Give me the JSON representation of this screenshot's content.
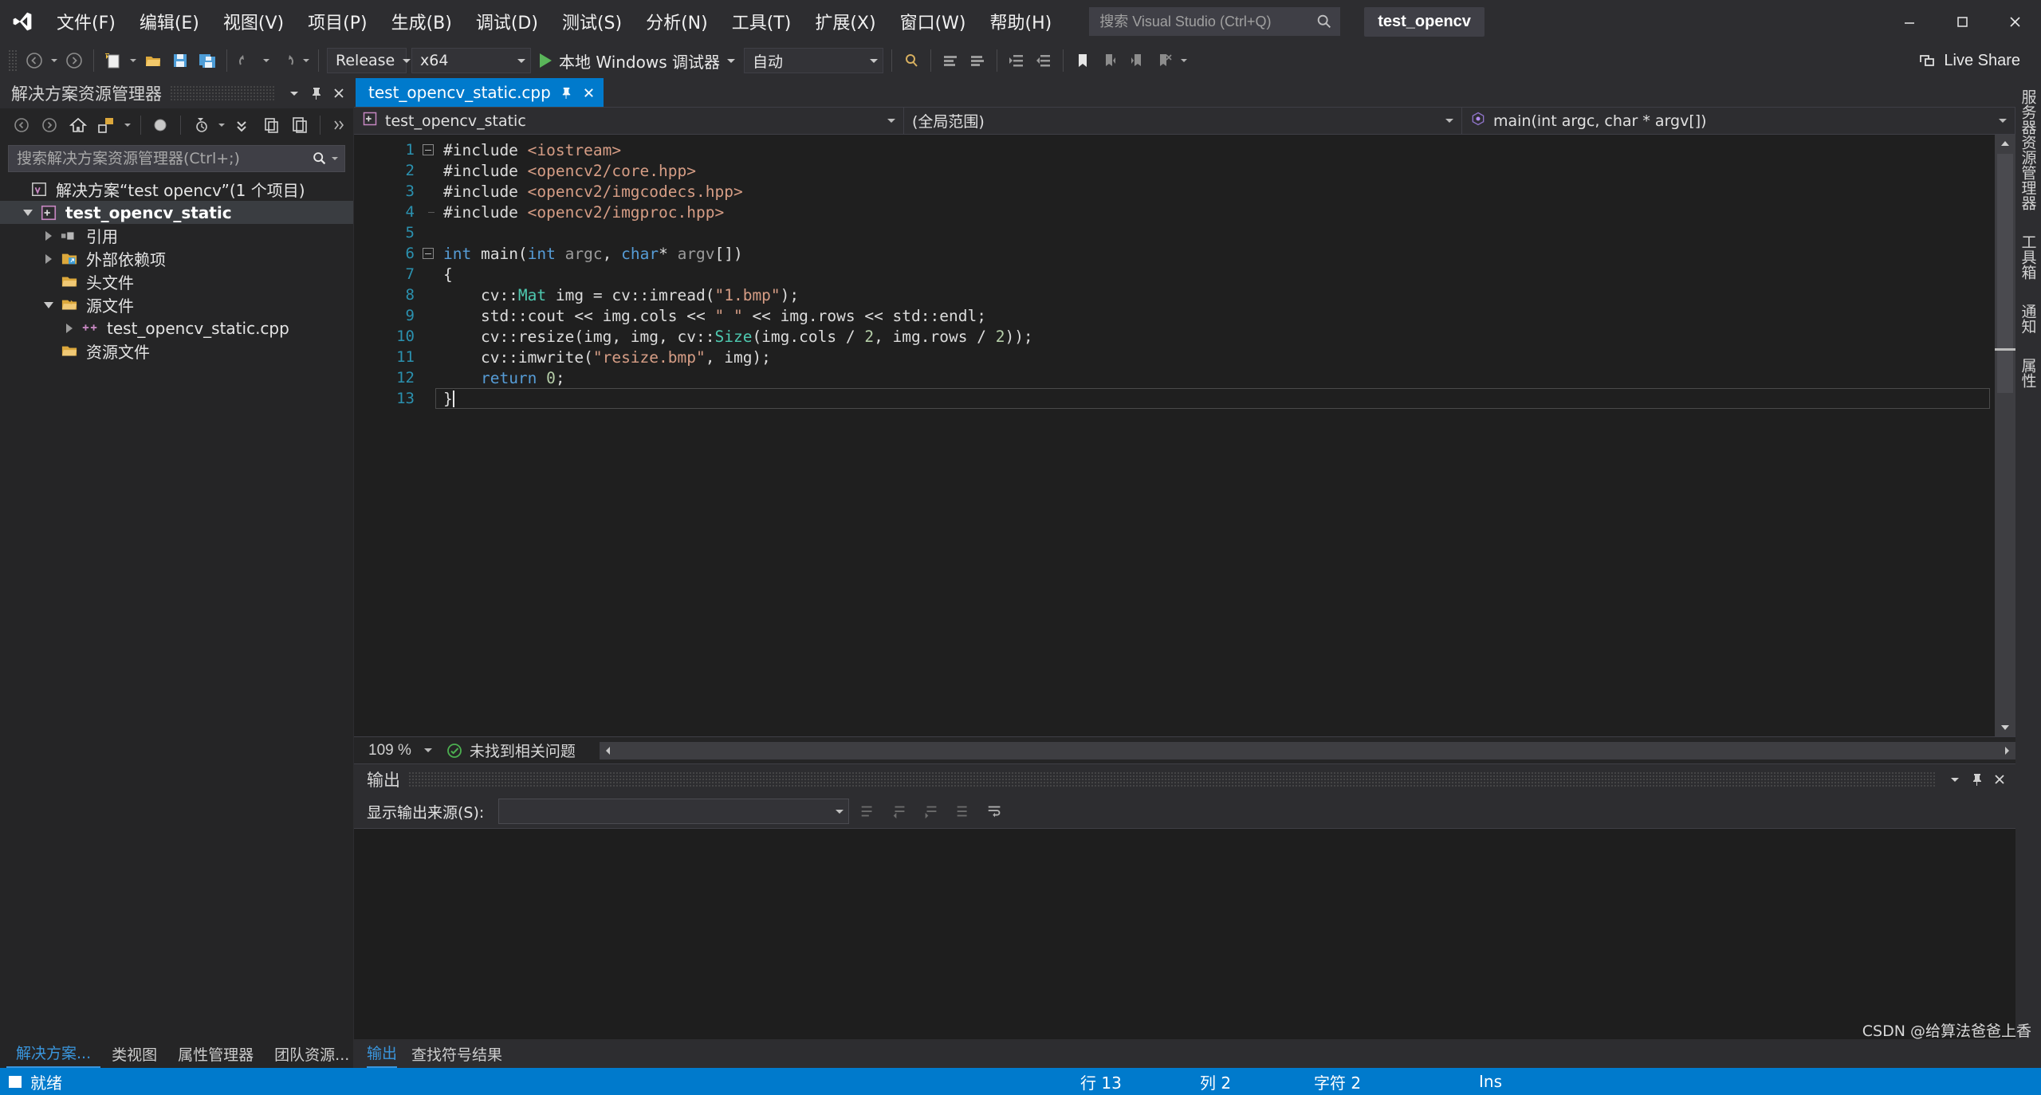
{
  "titlebar": {
    "logo_icon": "visual-studio-logo",
    "menus": [
      {
        "label": "文件(F)"
      },
      {
        "label": "编辑(E)"
      },
      {
        "label": "视图(V)"
      },
      {
        "label": "项目(P)"
      },
      {
        "label": "生成(B)"
      },
      {
        "label": "调试(D)"
      },
      {
        "label": "测试(S)"
      },
      {
        "label": "分析(N)"
      },
      {
        "label": "工具(T)"
      },
      {
        "label": "扩展(X)"
      },
      {
        "label": "窗口(W)"
      },
      {
        "label": "帮助(H)"
      }
    ],
    "search_placeholder": "搜索 Visual Studio (Ctrl+Q)",
    "search_value": "",
    "project_chip": "test_opencv",
    "window_buttons": {
      "minimize": "minimize-icon",
      "maximize": "maximize-icon",
      "close": "close-icon"
    }
  },
  "toolbar": {
    "nav_back": "navigate-back-icon",
    "nav_forward": "navigate-forward-icon",
    "new_project": "new-project-icon",
    "open_file": "open-file-icon",
    "save": "save-icon",
    "save_all": "save-all-icon",
    "undo": "undo-icon",
    "redo": "redo-icon",
    "configuration": "Release",
    "platform": "x64",
    "debug_target": "本地 Windows 调试器",
    "auto_mode": "自动",
    "live_share": "Live Share"
  },
  "solution_explorer": {
    "title": "解决方案资源管理器",
    "dropdown_icon": "chevron-down-icon",
    "pin_icon": "pin-icon",
    "close_icon": "close-icon",
    "toolbar_icons": [
      "back-icon",
      "forward-icon",
      "home-icon",
      "sync-with-active-doc-icon",
      "refresh-icon",
      "show-all-files-icon",
      "collapse-all-icon",
      "view-icon",
      "properties-icon"
    ],
    "search_placeholder": "搜索解决方案资源管理器(Ctrl+;)",
    "search_value": "",
    "tree": [
      {
        "label": "解决方案“test opencv”(1 个项目)",
        "icon": "solution-icon",
        "indent": 0,
        "twist": "none",
        "selected": false
      },
      {
        "label": "test_opencv_static",
        "icon": "cpp-project-icon",
        "indent": 1,
        "twist": "expanded",
        "selected": true
      },
      {
        "label": "引用",
        "icon": "references-icon",
        "indent": 2,
        "twist": "collapsed",
        "selected": false
      },
      {
        "label": "外部依赖项",
        "icon": "external-deps-icon",
        "indent": 2,
        "twist": "collapsed",
        "selected": false
      },
      {
        "label": "头文件",
        "icon": "folder-icon",
        "indent": 2,
        "twist": "none",
        "selected": false
      },
      {
        "label": "源文件",
        "icon": "folder-open-icon",
        "indent": 2,
        "twist": "expanded",
        "selected": false
      },
      {
        "label": "test_opencv_static.cpp",
        "icon": "cpp-file-icon",
        "indent": 3,
        "twist": "collapsed",
        "selected": false
      },
      {
        "label": "资源文件",
        "icon": "folder-icon",
        "indent": 2,
        "twist": "none",
        "selected": false
      }
    ],
    "bottom_tabs": [
      {
        "label": "解决方案...",
        "active": true
      },
      {
        "label": "类视图",
        "active": false
      },
      {
        "label": "属性管理器",
        "active": false
      },
      {
        "label": "团队资源...",
        "active": false
      }
    ]
  },
  "editor": {
    "tab_label": "test_opencv_static.cpp",
    "tab_pin_icon": "pin-icon",
    "tab_close_icon": "close-icon",
    "nav_project": "test_opencv_static",
    "nav_project_icon": "cpp-project-icon",
    "nav_scope": "(全局范围)",
    "nav_member": "main(int argc, char * argv[])",
    "nav_member_icon": "method-icon",
    "zoom_level": "109 %",
    "issue_status": "未找到相关问题",
    "issue_icon": "check-circle-icon",
    "lines": [
      {
        "n": "1",
        "fold": "start",
        "tokens": [
          {
            "t": "#include ",
            "c": "k-white"
          },
          {
            "t": "<iostream>",
            "c": "k-str"
          }
        ]
      },
      {
        "n": "2",
        "fold": "mid",
        "tokens": [
          {
            "t": "#include ",
            "c": "k-white"
          },
          {
            "t": "<opencv2/core.hpp>",
            "c": "k-str"
          }
        ]
      },
      {
        "n": "3",
        "fold": "mid",
        "tokens": [
          {
            "t": "#include ",
            "c": "k-white"
          },
          {
            "t": "<opencv2/imgcodecs.hpp>",
            "c": "k-str"
          }
        ]
      },
      {
        "n": "4",
        "fold": "end",
        "tokens": [
          {
            "t": "#include ",
            "c": "k-white"
          },
          {
            "t": "<opencv2/imgproc.hpp>",
            "c": "k-str"
          }
        ]
      },
      {
        "n": "5",
        "fold": "none",
        "tokens": []
      },
      {
        "n": "6",
        "fold": "start",
        "tokens": [
          {
            "t": "int",
            "c": "k-blue"
          },
          {
            "t": " main(",
            "c": "k-white"
          },
          {
            "t": "int",
            "c": "k-blue"
          },
          {
            "t": " ",
            "c": "k-white"
          },
          {
            "t": "argc",
            "c": "k-id"
          },
          {
            "t": ", ",
            "c": "k-white"
          },
          {
            "t": "char",
            "c": "k-blue"
          },
          {
            "t": "* ",
            "c": "k-white"
          },
          {
            "t": "argv",
            "c": "k-id"
          },
          {
            "t": "[])",
            "c": "k-white"
          }
        ]
      },
      {
        "n": "7",
        "fold": "bar",
        "tokens": [
          {
            "t": "{",
            "c": "k-white"
          }
        ]
      },
      {
        "n": "8",
        "fold": "bardot",
        "tokens": [
          {
            "t": "    cv::",
            "c": "k-white"
          },
          {
            "t": "Mat",
            "c": "k-type"
          },
          {
            "t": " img = cv::imread(",
            "c": "k-white"
          },
          {
            "t": "\"1.bmp\"",
            "c": "k-str"
          },
          {
            "t": ");",
            "c": "k-white"
          }
        ]
      },
      {
        "n": "9",
        "fold": "bardot",
        "tokens": [
          {
            "t": "    std::cout << img.cols << ",
            "c": "k-white"
          },
          {
            "t": "\" \"",
            "c": "k-str"
          },
          {
            "t": " << img.rows << std::endl;",
            "c": "k-white"
          }
        ]
      },
      {
        "n": "10",
        "fold": "bardot",
        "tokens": [
          {
            "t": "    cv::resize(img, img, cv::",
            "c": "k-white"
          },
          {
            "t": "Size",
            "c": "k-type"
          },
          {
            "t": "(img.cols / ",
            "c": "k-white"
          },
          {
            "t": "2",
            "c": "k-num"
          },
          {
            "t": ", img.rows / ",
            "c": "k-white"
          },
          {
            "t": "2",
            "c": "k-num"
          },
          {
            "t": "));",
            "c": "k-white"
          }
        ]
      },
      {
        "n": "11",
        "fold": "bardot",
        "tokens": [
          {
            "t": "    cv::imwrite(",
            "c": "k-white"
          },
          {
            "t": "\"resize.bmp\"",
            "c": "k-str"
          },
          {
            "t": ", img);",
            "c": "k-white"
          }
        ]
      },
      {
        "n": "12",
        "fold": "bardot",
        "tokens": [
          {
            "t": "    ",
            "c": "k-white"
          },
          {
            "t": "return",
            "c": "k-blue"
          },
          {
            "t": " ",
            "c": "k-white"
          },
          {
            "t": "0",
            "c": "k-num"
          },
          {
            "t": ";",
            "c": "k-white"
          }
        ]
      },
      {
        "n": "13",
        "fold": "barend",
        "tokens": [
          {
            "t": "}",
            "c": "k-white"
          }
        ]
      }
    ]
  },
  "output_panel": {
    "title": "输出",
    "pin_icon": "pin-icon",
    "close_icon": "close-icon",
    "dropdown_icon": "chevron-down-icon",
    "source_label": "显示输出来源(S):",
    "source_value": "",
    "toolbar_icons": [
      "go-to-message-icon",
      "go-to-previous-icon",
      "go-to-next-icon",
      "clear-all-icon",
      "toggle-word-wrap-icon"
    ],
    "content": "",
    "tabs": [
      {
        "label": "输出",
        "active": true
      },
      {
        "label": "查找符号结果",
        "active": false
      }
    ]
  },
  "right_rail": [
    {
      "label": "服务器资源管理器"
    },
    {
      "label": "工具箱"
    },
    {
      "label": "通知"
    },
    {
      "label": "属性"
    }
  ],
  "statusbar": {
    "state_icon": "ready-icon",
    "state": "就绪",
    "line": "行 13",
    "column": "列 2",
    "character": "字符 2",
    "insert_mode": "Ins"
  },
  "watermark": "CSDN @给算法爸爸上香",
  "colors": {
    "accent": "#007acc",
    "tab_active_bg": "#007acc",
    "chrome_bg": "#2d2d30",
    "panel_bg": "#252526",
    "editor_bg": "#1f1f1f",
    "link_blue": "#3a96dd"
  }
}
